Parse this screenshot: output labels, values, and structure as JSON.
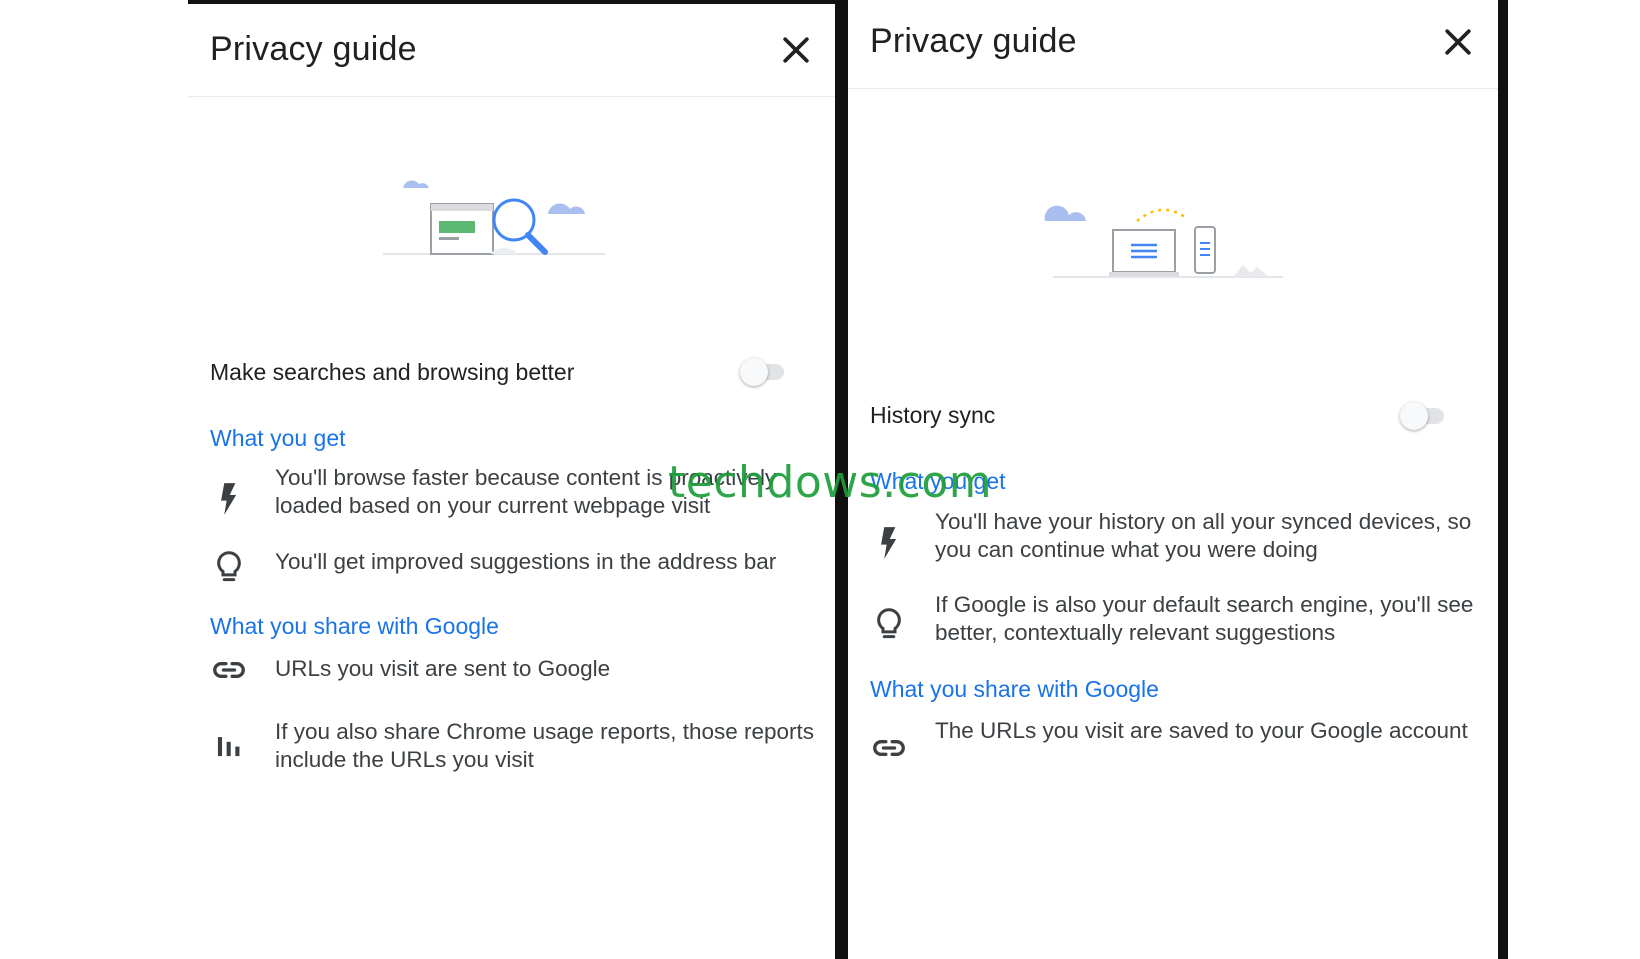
{
  "left": {
    "title": "Privacy guide",
    "setting_label": "Make searches and browsing better",
    "toggle_on": false,
    "what_you_get": {
      "heading": "What you get",
      "items": [
        {
          "icon": "bolt-icon",
          "text": "You'll browse faster because content is proactively loaded based on your current webpage visit"
        },
        {
          "icon": "lightbulb-icon",
          "text": "You'll get improved suggestions in the address bar"
        }
      ]
    },
    "what_you_share": {
      "heading": "What you share with Google",
      "items": [
        {
          "icon": "link-icon",
          "text": "URLs you visit are sent to Google"
        },
        {
          "icon": "bar-chart-icon",
          "text": "If you also share Chrome usage reports, those reports include the URLs you visit"
        }
      ]
    }
  },
  "right": {
    "title": "Privacy guide",
    "setting_label": "History sync",
    "toggle_on": false,
    "what_you_get": {
      "heading": "What you get",
      "items": [
        {
          "icon": "bolt-icon",
          "text": "You'll have your history on all your synced devices, so you can continue what you were doing"
        },
        {
          "icon": "lightbulb-icon",
          "text": "If Google is also your default search engine, you'll see better, contextually relevant suggestions"
        }
      ]
    },
    "what_you_share": {
      "heading": "What you share with Google",
      "items": [
        {
          "icon": "link-icon",
          "text": "The URLs you visit are saved to your Google account"
        }
      ]
    }
  },
  "watermark": "techdows.com",
  "colors": {
    "accent": "#1a73e8",
    "text": "#202124",
    "watermark": "#1e9e3a"
  }
}
